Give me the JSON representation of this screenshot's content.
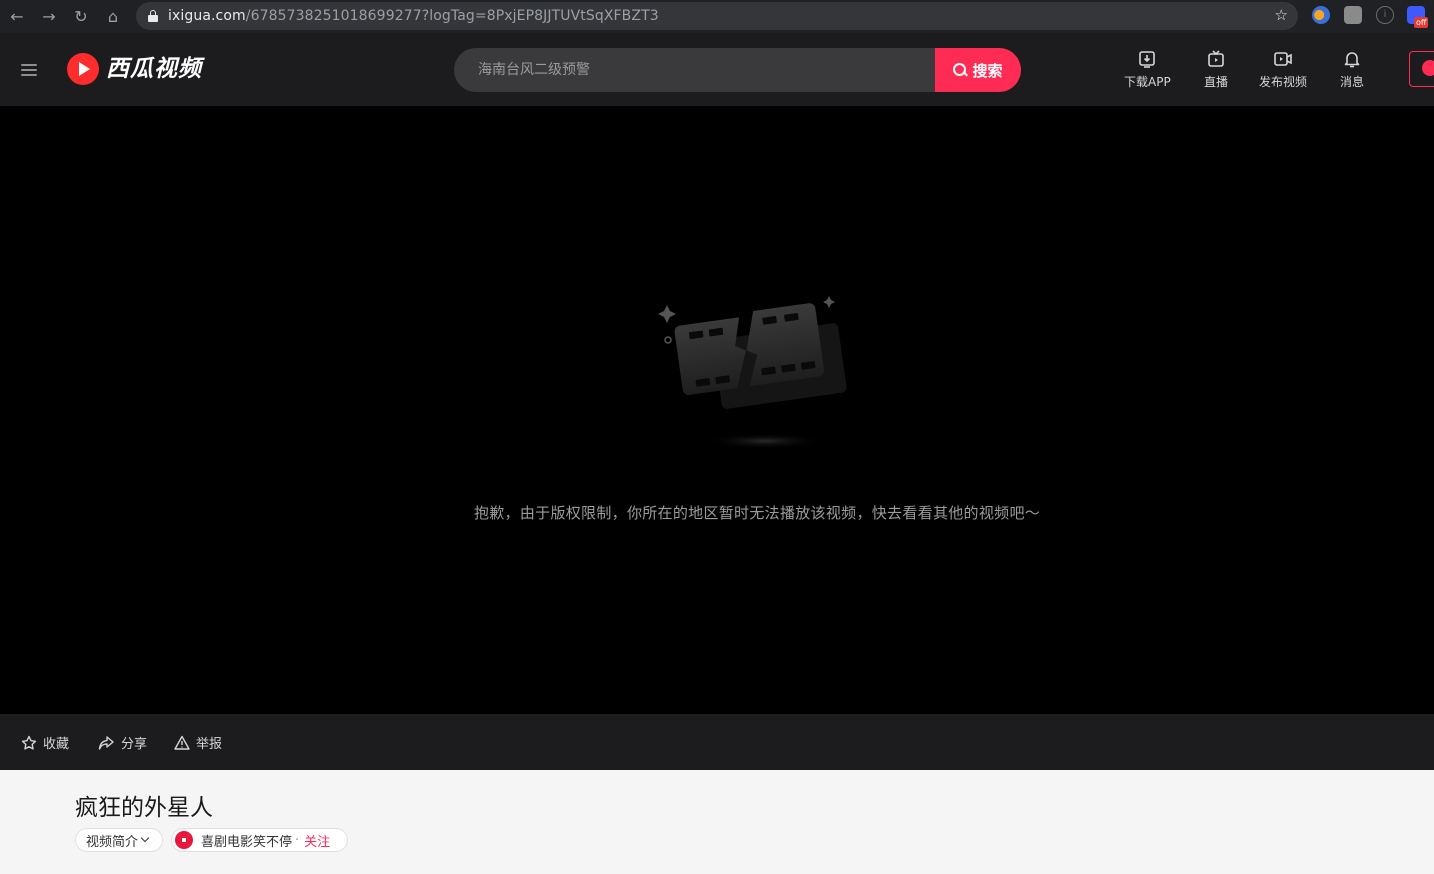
{
  "browser": {
    "url_host": "ixigua.com",
    "url_path": "/6785738251018699277?logTag=8PxjEP8JJTUVtSqXFBZT3",
    "extension_badge": "off"
  },
  "header": {
    "logo_text": "西瓜视频",
    "search": {
      "placeholder": "海南台风二级预警",
      "button_label": "搜索"
    },
    "nav": [
      {
        "label": "下载APP",
        "icon": "download-icon"
      },
      {
        "label": "直播",
        "icon": "live-tv-icon"
      },
      {
        "label": "发布视频",
        "icon": "upload-video-icon"
      },
      {
        "label": "消息",
        "icon": "bell-icon"
      }
    ]
  },
  "player": {
    "message": "抱歉，由于版权限制，你所在的地区暂时无法播放该视频，快去看看其他的视频吧～"
  },
  "actions": {
    "favorite": "收藏",
    "share": "分享",
    "report": "举报"
  },
  "video": {
    "title": "疯狂的外星人",
    "desc_label": "视频简介",
    "author_name": "喜剧电影笑不停",
    "separator": "·",
    "follow_label": "关注"
  },
  "colors": {
    "accent": "#fe2c55",
    "header_bg": "#1c1c1e",
    "page_bg": "#000000",
    "info_bg": "#f5f5f5"
  }
}
